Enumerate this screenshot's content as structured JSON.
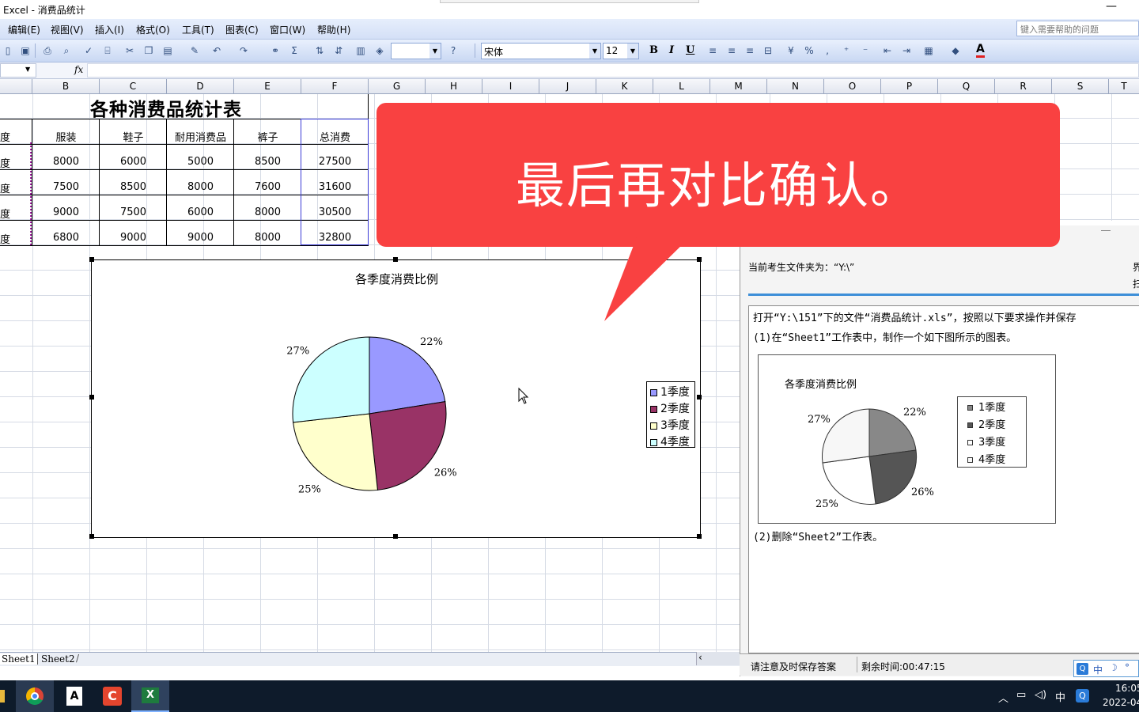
{
  "window": {
    "title": "Excel - 消费品统计"
  },
  "menu": {
    "items": [
      "编辑(E)",
      "视图(V)",
      "插入(I)",
      "格式(O)",
      "工具(T)",
      "图表(C)",
      "窗口(W)",
      "帮助(H)"
    ],
    "help_placeholder": "键入需要帮助的问题"
  },
  "toolbar": {
    "font_name": "宋体",
    "font_size": "12",
    "bold": "B",
    "italic": "I",
    "underline": "U",
    "font_color_letter": "A"
  },
  "formula_bar": {
    "fx": "fx"
  },
  "columns": [
    "B",
    "C",
    "D",
    "E",
    "F",
    "G",
    "H",
    "I",
    "J",
    "K",
    "L",
    "M",
    "N",
    "O",
    "P",
    "Q",
    "R",
    "S",
    "T"
  ],
  "sheet": {
    "title": "各种消费品统计表",
    "headers": [
      "度",
      "服装",
      "鞋子",
      "耐用消费品",
      "裤子",
      "总消费"
    ],
    "rows": [
      [
        "度",
        "8000",
        "6000",
        "5000",
        "8500",
        "27500"
      ],
      [
        "度",
        "7500",
        "8500",
        "8000",
        "7600",
        "31600"
      ],
      [
        "度",
        "9000",
        "7500",
        "6000",
        "8000",
        "30500"
      ],
      [
        "度",
        "6800",
        "9000",
        "9000",
        "8000",
        "32800"
      ]
    ]
  },
  "chart_data": {
    "type": "pie",
    "title": "各季度消费比例",
    "categories": [
      "1季度",
      "2季度",
      "3季度",
      "4季度"
    ],
    "values": [
      27500,
      31600,
      30500,
      32800
    ],
    "labels": [
      "22%",
      "26%",
      "25%",
      "27%"
    ],
    "colors": [
      "#9999ff",
      "#993366",
      "#ffffcc",
      "#ccffff"
    ],
    "legend_position": "right"
  },
  "callout": {
    "text": "最后再对比确认。"
  },
  "exam_panel": {
    "path_label": "当前考生文件夹为：“Y:\\”",
    "side_chars": [
      "界",
      "扫"
    ],
    "instruction_1": "打开“Y:\\151”下的文件“消费品统计.xls”，按照以下要求操作并保存",
    "instruction_2": "(1)在“Sheet1”工作表中，制作一个如下图所示的图表。",
    "instruction_3": "(2)删除“Sheet2”工作表。",
    "ref_chart": {
      "title": "各季度消费比例",
      "legend": [
        "1季度",
        "2季度",
        "3季度",
        "4季度"
      ],
      "labels": [
        "22%",
        "26%",
        "25%",
        "27%"
      ]
    },
    "status_left": "请注意及时保存答案",
    "status_right": "剩余时间:00:47:15"
  },
  "sheet_tabs": [
    "Sheet1",
    "Sheet2"
  ],
  "ime": {
    "lang": "中"
  },
  "taskbar": {
    "lang": "中",
    "time": "16:05",
    "date": "2022-04"
  }
}
